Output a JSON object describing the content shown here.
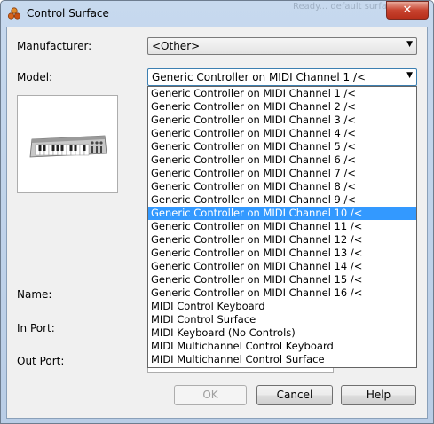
{
  "window": {
    "title": "Control Surface",
    "close_label": "✕",
    "ghost_text": "Ready... default surface"
  },
  "form": {
    "manufacturer_label": "Manufacturer:",
    "manufacturer_value": "<Other>",
    "model_label": "Model:",
    "model_value": "Generic Controller on MIDI Channel  1 /<",
    "name_label": "Name:",
    "in_port_label": "In Port:",
    "out_port_label": "Out Port:"
  },
  "model_options": [
    "Generic Controller on MIDI Channel  1 /<",
    "Generic Controller on MIDI Channel  2 /<",
    "Generic Controller on MIDI Channel  3 /<",
    "Generic Controller on MIDI Channel  4 /<",
    "Generic Controller on MIDI Channel  5 /<",
    "Generic Controller on MIDI Channel  6 /<",
    "Generic Controller on MIDI Channel  7 /<",
    "Generic Controller on MIDI Channel  8 /<",
    "Generic Controller on MIDI Channel  9 /<",
    "Generic Controller on MIDI Channel 10 /<",
    "Generic Controller on MIDI Channel 11 /<",
    "Generic Controller on MIDI Channel 12 /<",
    "Generic Controller on MIDI Channel 13 /<",
    "Generic Controller on MIDI Channel 14 /<",
    "Generic Controller on MIDI Channel 15 /<",
    "Generic Controller on MIDI Channel 16 /<",
    "MIDI Control Keyboard",
    "MIDI Control Surface",
    "MIDI Keyboard (No Controls)",
    "MIDI Multichannel Control Keyboard",
    "MIDI Multichannel Control Surface"
  ],
  "highlighted_index": 9,
  "buttons": {
    "ok": "OK",
    "cancel": "Cancel",
    "help": "Help"
  },
  "colors": {
    "highlight": "#3399ff",
    "close_button": "#c8432f"
  }
}
